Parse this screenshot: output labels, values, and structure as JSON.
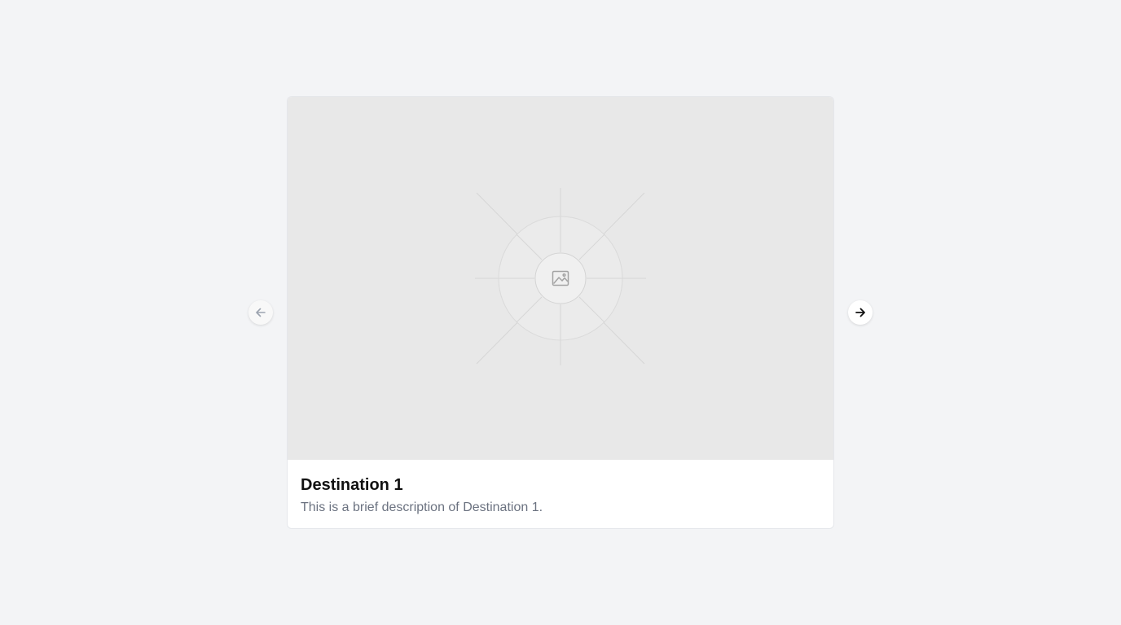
{
  "carousel": {
    "prev_icon": "arrow-left-icon",
    "next_icon": "arrow-right-icon",
    "slide": {
      "image_icon": "image-placeholder-icon",
      "title": "Destination 1",
      "description": "This is a brief description of Destination 1."
    }
  },
  "colors": {
    "page_background": "#f3f4f6",
    "image_placeholder": "#e8e8e8",
    "title_text": "#111111",
    "description_text": "#6b7280",
    "prev_arrow": "#9ca3af",
    "next_arrow": "#111111"
  }
}
